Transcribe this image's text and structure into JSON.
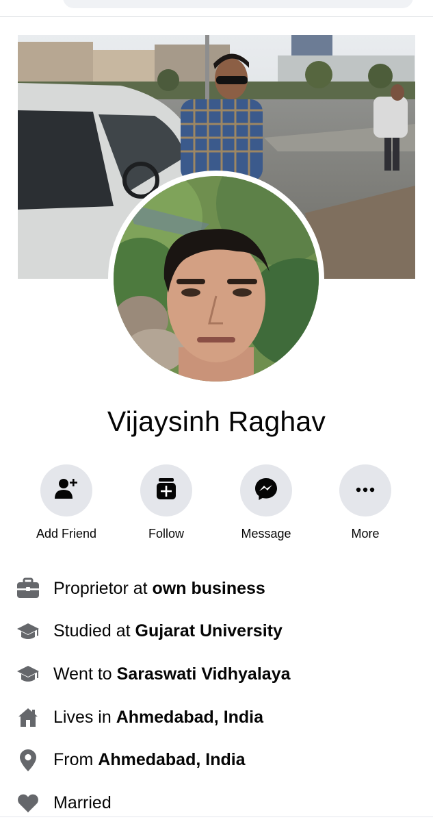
{
  "profile": {
    "name": "Vijaysinh Raghav"
  },
  "actions": [
    {
      "label": "Add Friend",
      "icon": "add-friend-icon"
    },
    {
      "label": "Follow",
      "icon": "follow-icon"
    },
    {
      "label": "Message",
      "icon": "messenger-icon"
    },
    {
      "label": "More",
      "icon": "more-icon"
    }
  ],
  "intro": [
    {
      "icon": "briefcase-icon",
      "prefix": "Proprietor at ",
      "bold": "own business"
    },
    {
      "icon": "graduation-cap-icon",
      "prefix": "Studied at ",
      "bold": "Gujarat University"
    },
    {
      "icon": "graduation-cap-icon",
      "prefix": "Went to ",
      "bold": "Saraswati Vidhyalaya"
    },
    {
      "icon": "home-icon",
      "prefix": "Lives in ",
      "bold": "Ahmedabad, India"
    },
    {
      "icon": "location-pin-icon",
      "prefix": "From ",
      "bold": "Ahmedabad, India"
    },
    {
      "icon": "heart-icon",
      "prefix": "Married",
      "bold": ""
    }
  ],
  "colors": {
    "button_bg": "#e4e6eb",
    "icon_gray": "#65676b",
    "text": "#050505"
  }
}
